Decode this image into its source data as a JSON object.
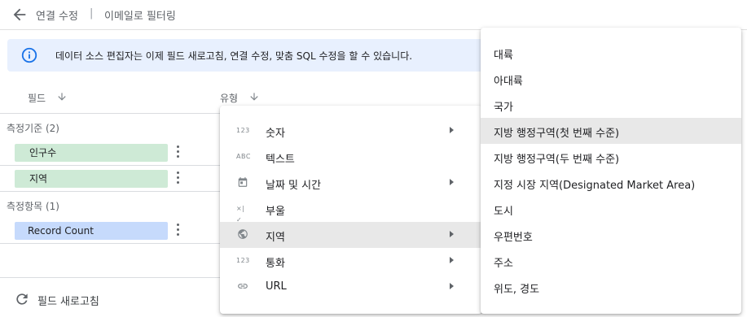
{
  "header": {
    "back_icon": "arrow-left-icon",
    "connection_edit": "연결 수정",
    "separator": "|",
    "filter_by_email": "이메일로 필터링"
  },
  "banner": {
    "icon": "info-icon",
    "message": "데이터 소스 편집자는 이제 필드 새로고침, 연결 수정, 맞춤 SQL 수정을 할 수 있습니다."
  },
  "columns": {
    "field": "필드",
    "type": "유형"
  },
  "dimensions": {
    "title": "측정기준 (2)",
    "items": [
      {
        "label": "인구수"
      },
      {
        "label": "지역"
      }
    ]
  },
  "metrics": {
    "title": "측정항목 (1)",
    "items": [
      {
        "label": "Record Count"
      }
    ]
  },
  "footer": {
    "refresh_label": "필드 새로고침"
  },
  "type_menu": {
    "items": [
      {
        "icon": "123",
        "label": "숫자"
      },
      {
        "icon": "ABC",
        "label": "텍스트"
      },
      {
        "icon": "calendar-icon",
        "label": "날짜 및 시간"
      },
      {
        "icon": "×|✓",
        "label": "부울"
      },
      {
        "icon": "globe-icon",
        "label": "지역"
      },
      {
        "icon": "123",
        "label": "통화"
      },
      {
        "icon": "link-icon",
        "label": "URL"
      }
    ],
    "active_index": 4
  },
  "geo_menu": {
    "items": [
      {
        "label": "대륙"
      },
      {
        "label": "아대륙"
      },
      {
        "label": "국가"
      },
      {
        "label": "지방 행정구역(첫 번째 수준)"
      },
      {
        "label": "지방 행정구역(두 번째 수준)"
      },
      {
        "label": "지정 시장 지역(Designated Market Area)"
      },
      {
        "label": "도시"
      },
      {
        "label": "우편번호"
      },
      {
        "label": "주소"
      },
      {
        "label": "위도, 경도"
      }
    ],
    "active_index": 3
  },
  "colors": {
    "dimension_chip": "#ceead6",
    "metric_chip": "#c6dafc",
    "banner_bg": "#e8f0fe",
    "info_icon": "#1a73e8"
  }
}
